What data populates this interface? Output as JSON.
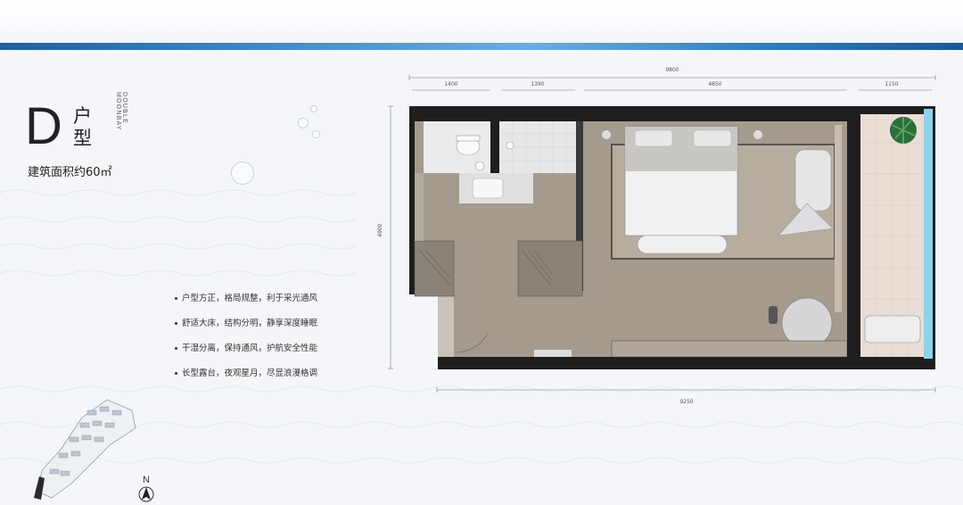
{
  "header": {
    "unit_letter": "D",
    "unit_label_chars": [
      "户",
      "型"
    ],
    "brand_vertical_lines": [
      "DOUBLE",
      "MOONBAY"
    ],
    "area_text": "建筑面积约60㎡"
  },
  "features": [
    "户型方正，格局规整，利于采光通风",
    "舒适大床，结构分明，静享深度睡眠",
    "干湿分离，保持通风，护航安全性能",
    "长型露台，夜观星月，尽显浪漫格调"
  ],
  "dimensions": {
    "top_total": "9800",
    "top_segments": [
      "1400",
      "1390",
      "4850",
      "1150"
    ],
    "left_height": "4900",
    "bottom_total": "9250"
  },
  "compass": {
    "label": "N"
  },
  "colors": {
    "accent_blue": "#2f7dbe",
    "wall": "#1e1e1e",
    "floor": "#a49a8e",
    "bath_tile": "#e8e8e8",
    "balcony_tile": "#e9ddd6",
    "balcony_glass": "#8fd3e8"
  },
  "icons": [
    "compass-arrow-icon",
    "plant-icon",
    "toilet-icon",
    "sink-icon",
    "bed-icon",
    "sofa-icon",
    "armchair-icon",
    "round-table-icon"
  ]
}
